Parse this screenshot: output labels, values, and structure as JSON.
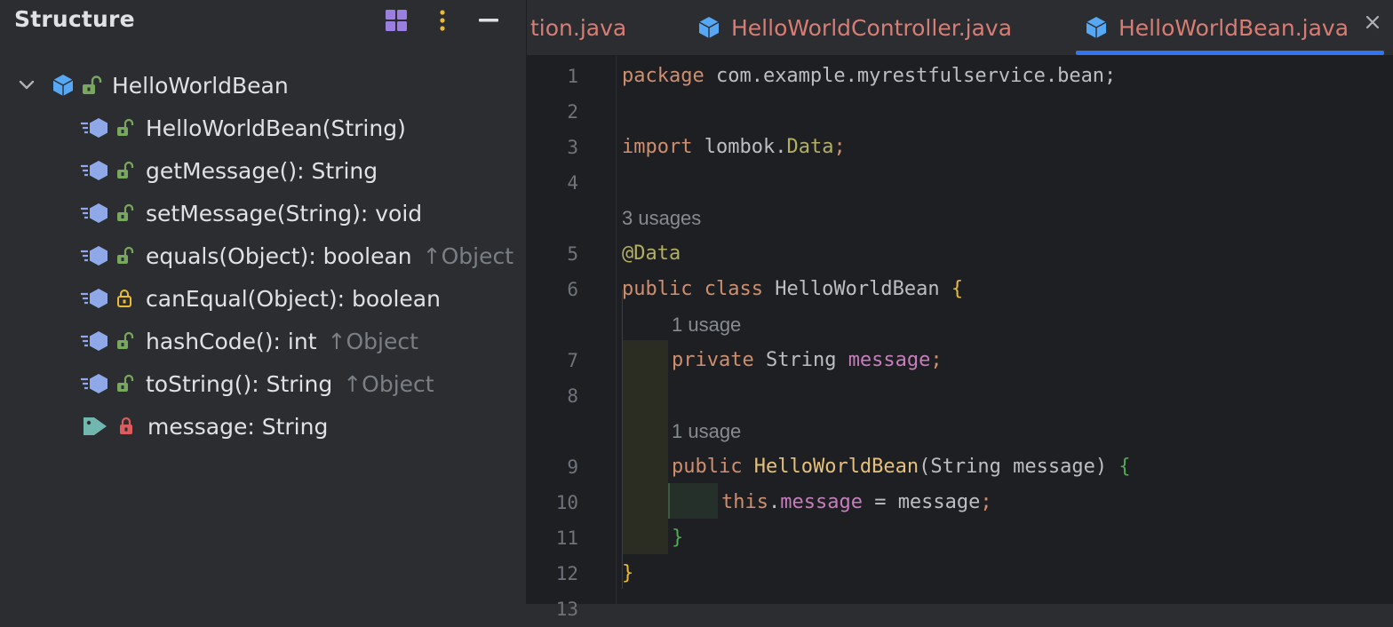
{
  "structure": {
    "title": "Structure",
    "root": {
      "label": "HelloWorldBean"
    },
    "members": [
      {
        "label": "HelloWorldBean(String)",
        "inherited": "",
        "kind": "method",
        "access": "public"
      },
      {
        "label": "getMessage(): String",
        "inherited": "",
        "kind": "method",
        "access": "public"
      },
      {
        "label": "setMessage(String): void",
        "inherited": "",
        "kind": "method",
        "access": "public"
      },
      {
        "label": "equals(Object): boolean",
        "inherited": "↑Object",
        "kind": "method",
        "access": "public"
      },
      {
        "label": "canEqual(Object): boolean",
        "inherited": "",
        "kind": "method",
        "access": "protected"
      },
      {
        "label": "hashCode(): int",
        "inherited": "↑Object",
        "kind": "method",
        "access": "public"
      },
      {
        "label": "toString(): String",
        "inherited": "↑Object",
        "kind": "method",
        "access": "public"
      },
      {
        "label": "message: String",
        "inherited": "",
        "kind": "field",
        "access": "private"
      }
    ]
  },
  "editor": {
    "tabs": [
      {
        "label": "tion.java",
        "active": false
      },
      {
        "label": "HelloWorldController.java",
        "active": false
      },
      {
        "label": "HelloWorldBean.java",
        "active": true
      }
    ],
    "line_numbers": [
      "1",
      "2",
      "3",
      "4",
      "5",
      "6",
      "7",
      "8",
      "9",
      "10",
      "11",
      "12",
      "13"
    ],
    "hints": {
      "usages_3": "3 usages",
      "usage_1a": "1 usage",
      "usage_1b": "1 usage"
    },
    "code": {
      "l1_kw": "package",
      "l1_rest": " com.example.myrestfulservice.bean;",
      "l3_kw": "import",
      "l3_pkg": " lombok.",
      "l3_cls": "Data",
      "l3_semi": ";",
      "l5_ann": "@Data",
      "l6_kw": "public class",
      "l6_name": " HelloWorldBean ",
      "l6_brace": "{",
      "l7_kw": "private",
      "l7_type": " String ",
      "l7_field": "message",
      "l7_semi": ";",
      "l9_kw": "public",
      "l9_fn": " HelloWorldBean",
      "l9_paren": "(String message) ",
      "l9_brace": "{",
      "l10_this": "this",
      "l10_dot": ".",
      "l10_field": "message",
      "l10_rest": " = message",
      "l10_semi": ";",
      "l11_brace": "}",
      "l12_brace": "}"
    }
  },
  "colors": {
    "panel_bg": "#2b2d30",
    "editor_bg": "#1e1f22",
    "tab_text": "#d87c74",
    "accent": "#3574f0",
    "class_icon": "#56a8f5",
    "lock_public": "#78a85f",
    "lock_protected": "#e8ba36",
    "lock_private": "#db5c5c"
  },
  "icons": {
    "header": [
      "layout-icon",
      "more-vertical-icon",
      "minimize-icon"
    ],
    "member": [
      "method-class-icon",
      "lock-icon"
    ],
    "field": "tag-icon"
  }
}
